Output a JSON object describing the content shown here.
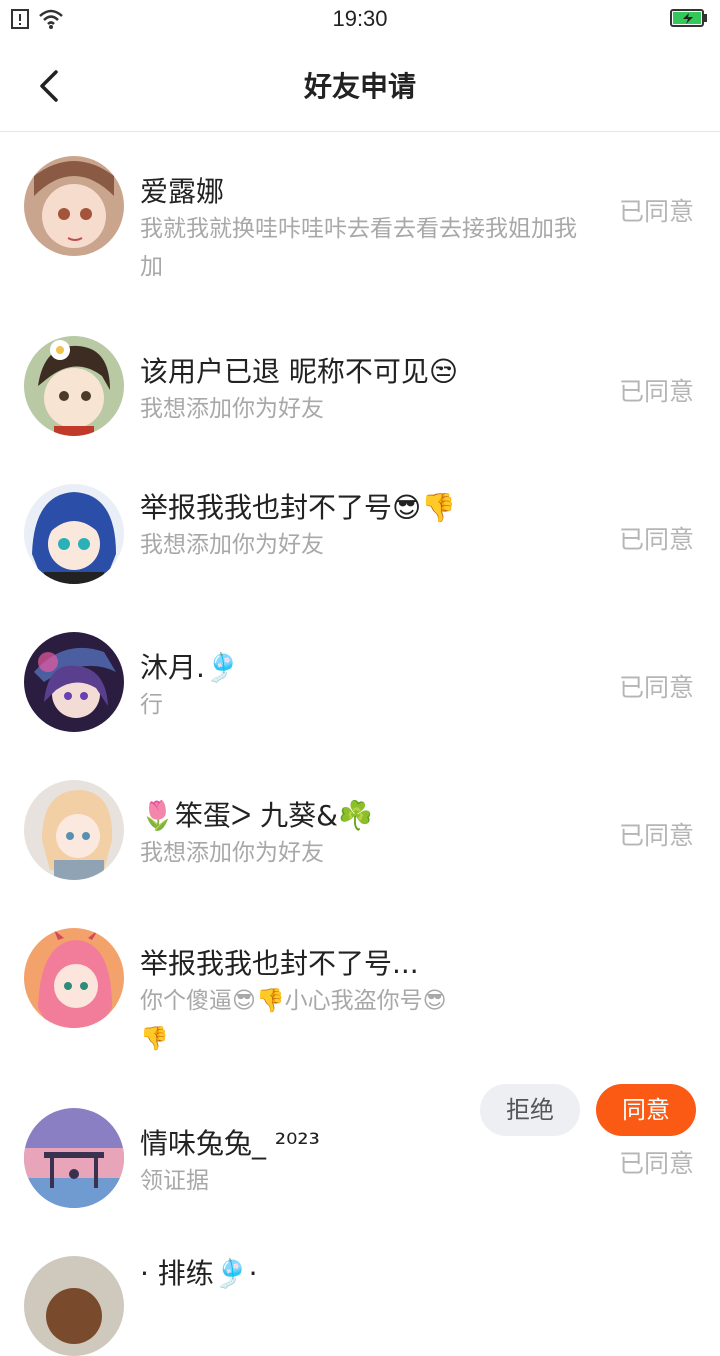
{
  "status_bar": {
    "time": "19:30",
    "icons": [
      "sim-alert-icon",
      "wifi-icon",
      "battery-charging-icon"
    ]
  },
  "header": {
    "title": "好友申请",
    "back_icon": "chevron-left-icon"
  },
  "requests": [
    {
      "name": "爱露娜",
      "message": "我就我就换哇咔哇咔去看去看去接我姐加我加",
      "status": "已同意"
    },
    {
      "name": "该用户已退 昵称不可见😒",
      "message": "我想添加你为好友",
      "status": "已同意"
    },
    {
      "name": "举报我我也封不了号😎👎",
      "message": "我想添加你为好友",
      "status": "已同意"
    },
    {
      "name": "沐月.🎐",
      "message": "行",
      "status": "已同意"
    },
    {
      "name": "🌷笨蛋ᐳ 九葵&☘️",
      "message": "我想添加你为好友",
      "status": "已同意"
    },
    {
      "name": "举报我我也封不了号...",
      "message": "你个傻逼😎👎小心我盗你号😎👎",
      "reject_label": "拒绝",
      "accept_label": "同意"
    },
    {
      "name": "情味兔兔_ ²⁰²³",
      "message": "领证据",
      "status": "已同意"
    },
    {
      "name": "· 排练🎐·",
      "message": "",
      "status": ""
    }
  ],
  "colors": {
    "accent": "#fb5a15",
    "reject_bg": "#edeff3",
    "muted_text": "#a8a8a8"
  }
}
